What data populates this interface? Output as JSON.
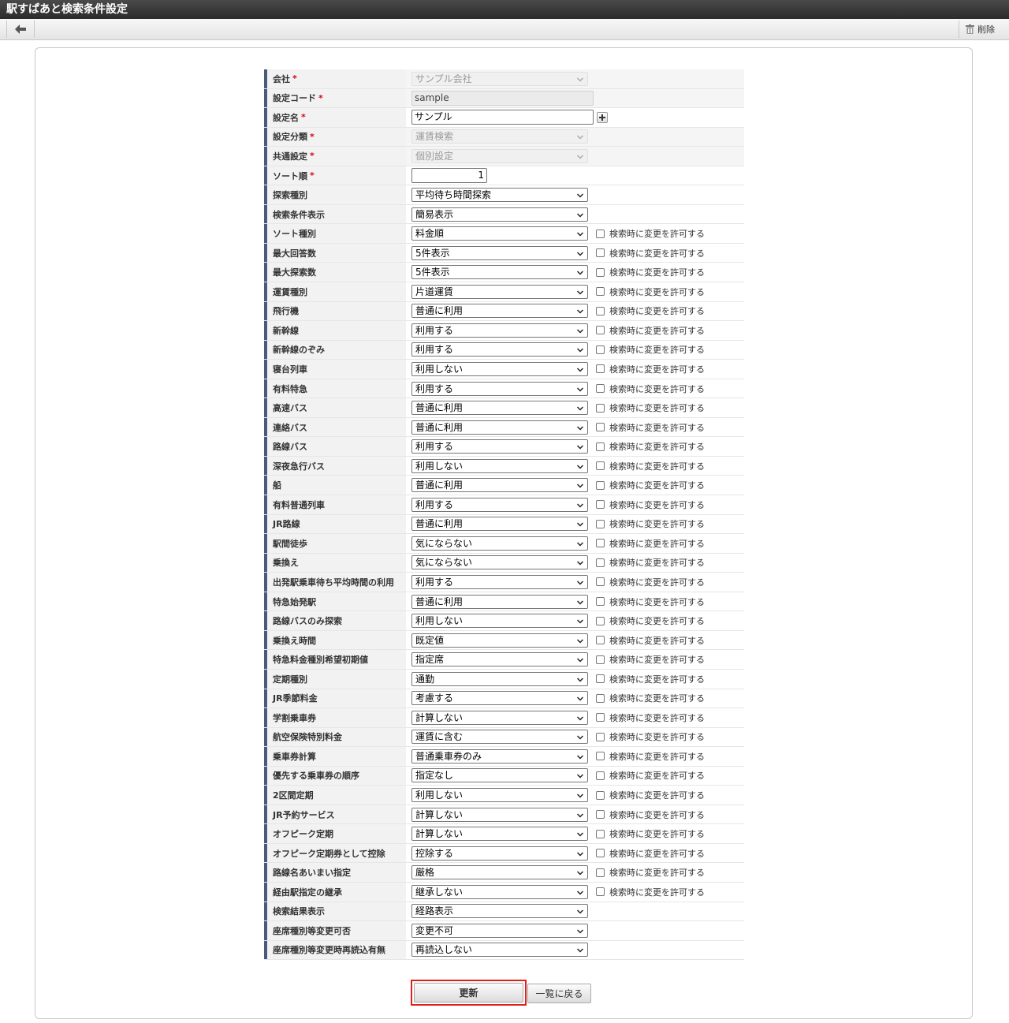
{
  "window": {
    "title": "駅すぱあと検索条件設定"
  },
  "toolbar": {
    "delete_label": "削除"
  },
  "form": {
    "allow_change_label": "検索時に変更を許可する",
    "fields": [
      {
        "label": "会社",
        "required": true,
        "type": "select",
        "value": "サンプル会社",
        "disabled": true,
        "checkbox": false
      },
      {
        "label": "設定コード",
        "required": true,
        "type": "readonly",
        "value": "sample",
        "checkbox": false
      },
      {
        "label": "設定名",
        "required": true,
        "type": "text",
        "value": "サンプル",
        "plus": true,
        "checkbox": false
      },
      {
        "label": "設定分類",
        "required": true,
        "type": "select",
        "value": "運賃検索",
        "disabled": true,
        "checkbox": false
      },
      {
        "label": "共通設定",
        "required": true,
        "type": "select",
        "value": "個別設定",
        "disabled": true,
        "checkbox": false
      },
      {
        "label": "ソート順",
        "required": true,
        "type": "number",
        "value": "1",
        "checkbox": false
      },
      {
        "label": "探索種別",
        "required": false,
        "type": "select",
        "value": "平均待ち時間探索",
        "checkbox": false
      },
      {
        "label": "検索条件表示",
        "required": false,
        "type": "select",
        "value": "簡易表示",
        "checkbox": false
      },
      {
        "label": "ソート種別",
        "required": false,
        "type": "select",
        "value": "料金順",
        "checkbox": true
      },
      {
        "label": "最大回答数",
        "required": false,
        "type": "select",
        "value": "5件表示",
        "checkbox": true
      },
      {
        "label": "最大探索数",
        "required": false,
        "type": "select",
        "value": "5件表示",
        "checkbox": true
      },
      {
        "label": "運賃種別",
        "required": false,
        "type": "select",
        "value": "片道運賃",
        "checkbox": true
      },
      {
        "label": "飛行機",
        "required": false,
        "type": "select",
        "value": "普通に利用",
        "checkbox": true
      },
      {
        "label": "新幹線",
        "required": false,
        "type": "select",
        "value": "利用する",
        "checkbox": true
      },
      {
        "label": "新幹線のぞみ",
        "required": false,
        "type": "select",
        "value": "利用する",
        "checkbox": true
      },
      {
        "label": "寝台列車",
        "required": false,
        "type": "select",
        "value": "利用しない",
        "checkbox": true
      },
      {
        "label": "有料特急",
        "required": false,
        "type": "select",
        "value": "利用する",
        "checkbox": true
      },
      {
        "label": "高速バス",
        "required": false,
        "type": "select",
        "value": "普通に利用",
        "checkbox": true
      },
      {
        "label": "連絡バス",
        "required": false,
        "type": "select",
        "value": "普通に利用",
        "checkbox": true
      },
      {
        "label": "路線バス",
        "required": false,
        "type": "select",
        "value": "利用する",
        "checkbox": true
      },
      {
        "label": "深夜急行バス",
        "required": false,
        "type": "select",
        "value": "利用しない",
        "checkbox": true
      },
      {
        "label": "船",
        "required": false,
        "type": "select",
        "value": "普通に利用",
        "checkbox": true
      },
      {
        "label": "有料普通列車",
        "required": false,
        "type": "select",
        "value": "利用する",
        "checkbox": true
      },
      {
        "label": "JR路線",
        "required": false,
        "type": "select",
        "value": "普通に利用",
        "checkbox": true
      },
      {
        "label": "駅間徒歩",
        "required": false,
        "type": "select",
        "value": "気にならない",
        "checkbox": true
      },
      {
        "label": "乗換え",
        "required": false,
        "type": "select",
        "value": "気にならない",
        "checkbox": true
      },
      {
        "label": "出発駅乗車待ち平均時間の利用",
        "required": false,
        "type": "select",
        "value": "利用する",
        "checkbox": true
      },
      {
        "label": "特急始発駅",
        "required": false,
        "type": "select",
        "value": "普通に利用",
        "checkbox": true
      },
      {
        "label": "路線バスのみ探索",
        "required": false,
        "type": "select",
        "value": "利用しない",
        "checkbox": true
      },
      {
        "label": "乗換え時間",
        "required": false,
        "type": "select",
        "value": "既定値",
        "checkbox": true
      },
      {
        "label": "特急料金種別希望初期値",
        "required": false,
        "type": "select",
        "value": "指定席",
        "checkbox": true
      },
      {
        "label": "定期種別",
        "required": false,
        "type": "select",
        "value": "通勤",
        "checkbox": true
      },
      {
        "label": "JR季節料金",
        "required": false,
        "type": "select",
        "value": "考慮する",
        "checkbox": true
      },
      {
        "label": "学割乗車券",
        "required": false,
        "type": "select",
        "value": "計算しない",
        "checkbox": true
      },
      {
        "label": "航空保険特別料金",
        "required": false,
        "type": "select",
        "value": "運賃に含む",
        "checkbox": true
      },
      {
        "label": "乗車券計算",
        "required": false,
        "type": "select",
        "value": "普通乗車券のみ",
        "checkbox": true
      },
      {
        "label": "優先する乗車券の順序",
        "required": false,
        "type": "select",
        "value": "指定なし",
        "checkbox": true
      },
      {
        "label": "2区間定期",
        "required": false,
        "type": "select",
        "value": "利用しない",
        "checkbox": true
      },
      {
        "label": "JR予約サービス",
        "required": false,
        "type": "select",
        "value": "計算しない",
        "checkbox": true
      },
      {
        "label": "オフピーク定期",
        "required": false,
        "type": "select",
        "value": "計算しない",
        "checkbox": true
      },
      {
        "label": "オフピーク定期券として控除",
        "required": false,
        "type": "select",
        "value": "控除する",
        "checkbox": true
      },
      {
        "label": "路線名あいまい指定",
        "required": false,
        "type": "select",
        "value": "厳格",
        "checkbox": true
      },
      {
        "label": "経由駅指定の継承",
        "required": false,
        "type": "select",
        "value": "継承しない",
        "checkbox": true
      },
      {
        "label": "検索結果表示",
        "required": false,
        "type": "select",
        "value": "経路表示",
        "checkbox": false
      },
      {
        "label": "座席種別等変更可否",
        "required": false,
        "type": "select",
        "value": "変更不可",
        "checkbox": false
      },
      {
        "label": "座席種別等変更時再読込有無",
        "required": false,
        "type": "select",
        "value": "再読込しない",
        "checkbox": false
      }
    ]
  },
  "actions": {
    "update_label": "更新",
    "back_label": "一覧に戻る"
  },
  "colors": {
    "required": "#d9001b",
    "label_accent": "#4a5a78",
    "highlight": "#e0201b"
  }
}
